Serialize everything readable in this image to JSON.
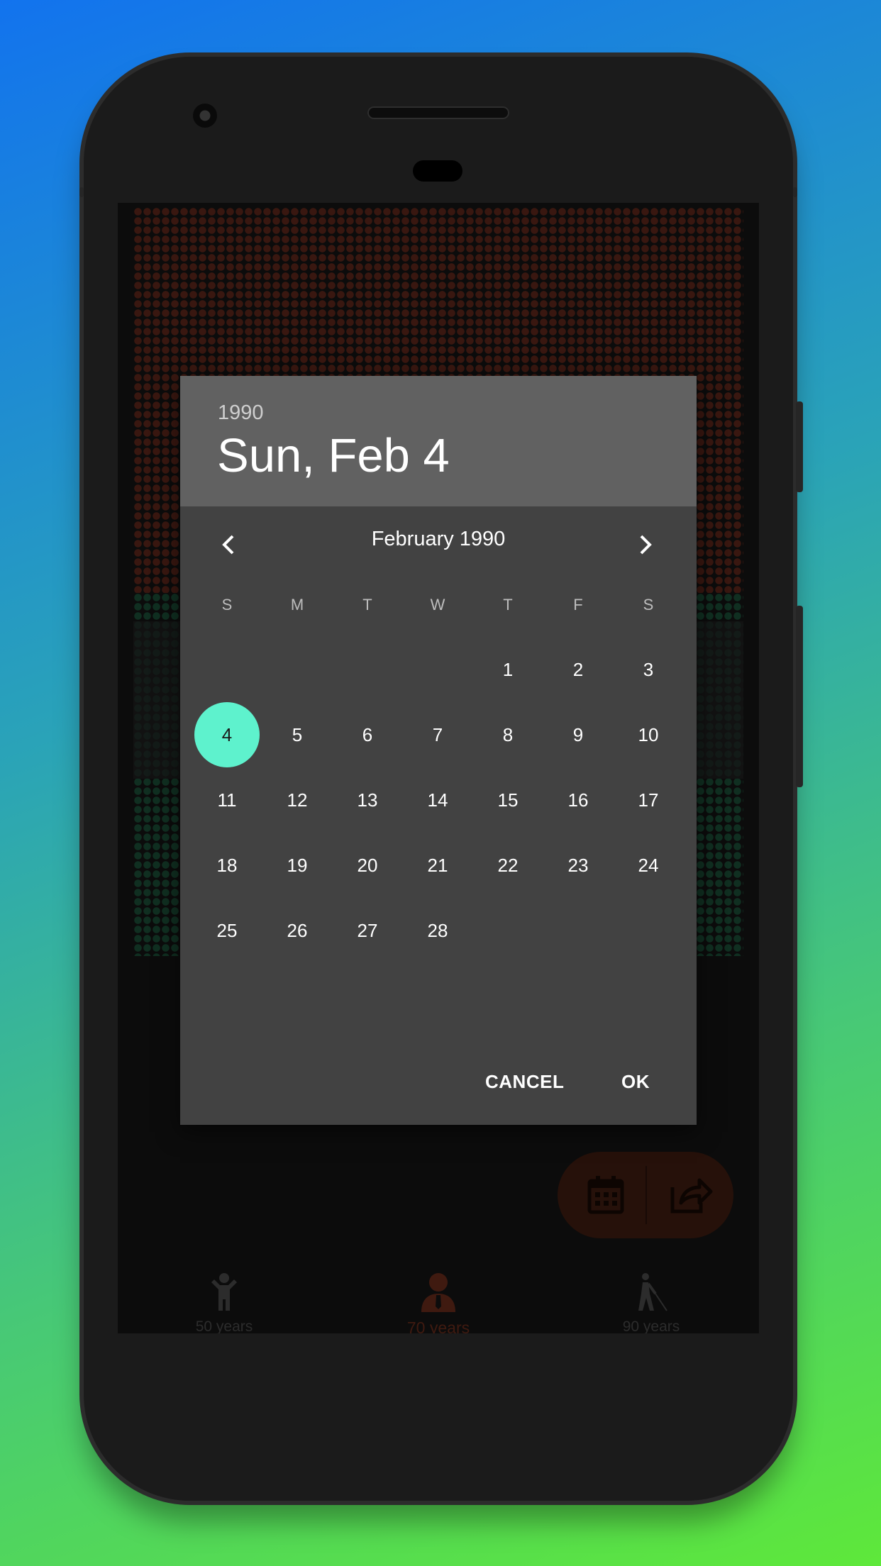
{
  "calendar_dialog": {
    "header_year": "1990",
    "header_date": "Sun, Feb 4",
    "month_label": "February 1990",
    "weekdays": [
      "S",
      "M",
      "T",
      "W",
      "T",
      "F",
      "S"
    ],
    "days": [
      "1",
      "2",
      "3",
      "4",
      "5",
      "6",
      "7",
      "8",
      "9",
      "10",
      "11",
      "12",
      "13",
      "14",
      "15",
      "16",
      "17",
      "18",
      "19",
      "20",
      "21",
      "22",
      "23",
      "24",
      "25",
      "26",
      "27",
      "28"
    ],
    "first_weekday_index": 4,
    "selected_day": "4",
    "cancel_label": "CANCEL",
    "ok_label": "OK",
    "prev_icon": "chevron-left-icon",
    "next_icon": "chevron-right-icon"
  },
  "fab": {
    "calendar_icon": "calendar-icon",
    "share_icon": "share-icon"
  },
  "bottom_nav": [
    {
      "label": "50 years",
      "icon": "child-icon",
      "active": false
    },
    {
      "label": "70 years",
      "icon": "adult-icon",
      "active": true
    },
    {
      "label": "90 years",
      "icon": "elderly-icon",
      "active": false
    }
  ],
  "colors": {
    "accent_selected": "#5ef2cd",
    "active_nav": "#7a3320",
    "inactive_nav": "#555555",
    "weeks_lived_dot": "#6e2d1f",
    "weeks_remaining_dot": "#1f5a40",
    "dialog_bg": "#424242",
    "dialog_header_bg": "#616161"
  }
}
